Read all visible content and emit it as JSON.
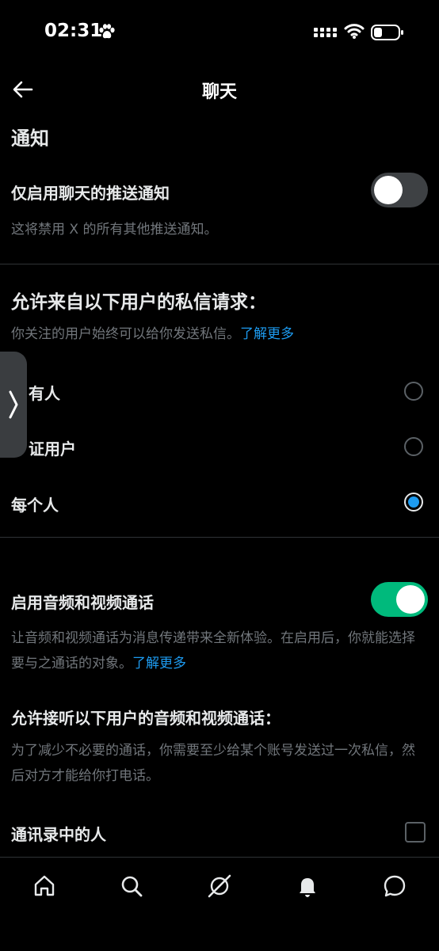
{
  "status_bar": {
    "time": "02:31"
  },
  "header": {
    "title": "聊天"
  },
  "notifications": {
    "section_title": "通知",
    "push_only_label": "仅启用聊天的推送通知",
    "push_only_desc": "这将禁用 X 的所有其他推送通知。",
    "push_only_enabled": false
  },
  "dm_requests": {
    "section_title": "允许来自以下用户的私信请求：",
    "desc": "你关注的用户始终可以给你发送私信。",
    "learn_more": "了解更多",
    "options": [
      {
        "label": "没有人",
        "visible_label": "有人",
        "selected": false
      },
      {
        "label": "认证用户",
        "visible_label": "证用户",
        "selected": false
      },
      {
        "label": "每个人",
        "visible_label": "每个人",
        "selected": true
      }
    ]
  },
  "calls": {
    "enable_label": "启用音频和视频通话",
    "enabled": true,
    "desc": "让音频和视频通话为消息传递带来全新体验。在启用后，你就能选择要与之通话的对象。",
    "learn_more": "了解更多",
    "allow_title": "允许接听以下用户的音频和视频通话：",
    "allow_desc": "为了减少不必要的通话，你需要至少给某个账号发送过一次私信，然后对方才能给你打电话。",
    "contacts_label": "通讯录中的人",
    "contacts_checked": false
  },
  "bottom_nav": {
    "icons": [
      "home-icon",
      "search-icon",
      "grok-icon",
      "notifications-icon",
      "messages-icon"
    ]
  },
  "colors": {
    "background": "#000000",
    "accent": "#1d9bf0",
    "toggle_on": "#00ba7c",
    "secondary_text": "#71767b"
  }
}
